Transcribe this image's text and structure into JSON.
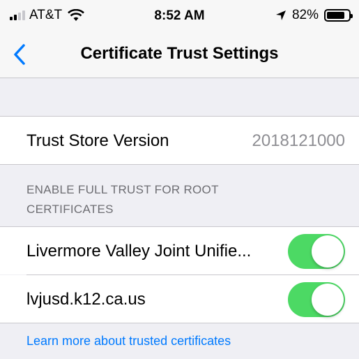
{
  "status": {
    "carrier": "AT&T",
    "time": "8:52 AM",
    "battery": "82%",
    "battery_level": 0.82
  },
  "nav": {
    "title": "Certificate Trust Settings"
  },
  "trust_store": {
    "label": "Trust Store Version",
    "value": "2018121000"
  },
  "section": {
    "header_line1": "ENABLE FULL TRUST FOR ROOT",
    "header_line2": "CERTIFICATES"
  },
  "certificates": [
    {
      "name": "Livermore Valley Joint Unifie...",
      "enabled": true
    },
    {
      "name": "lvjusd.k12.ca.us",
      "enabled": true
    }
  ],
  "footer": {
    "link": "Learn more about trusted certificates"
  },
  "colors": {
    "toggle_on": "#4cd964",
    "link": "#007aff"
  }
}
